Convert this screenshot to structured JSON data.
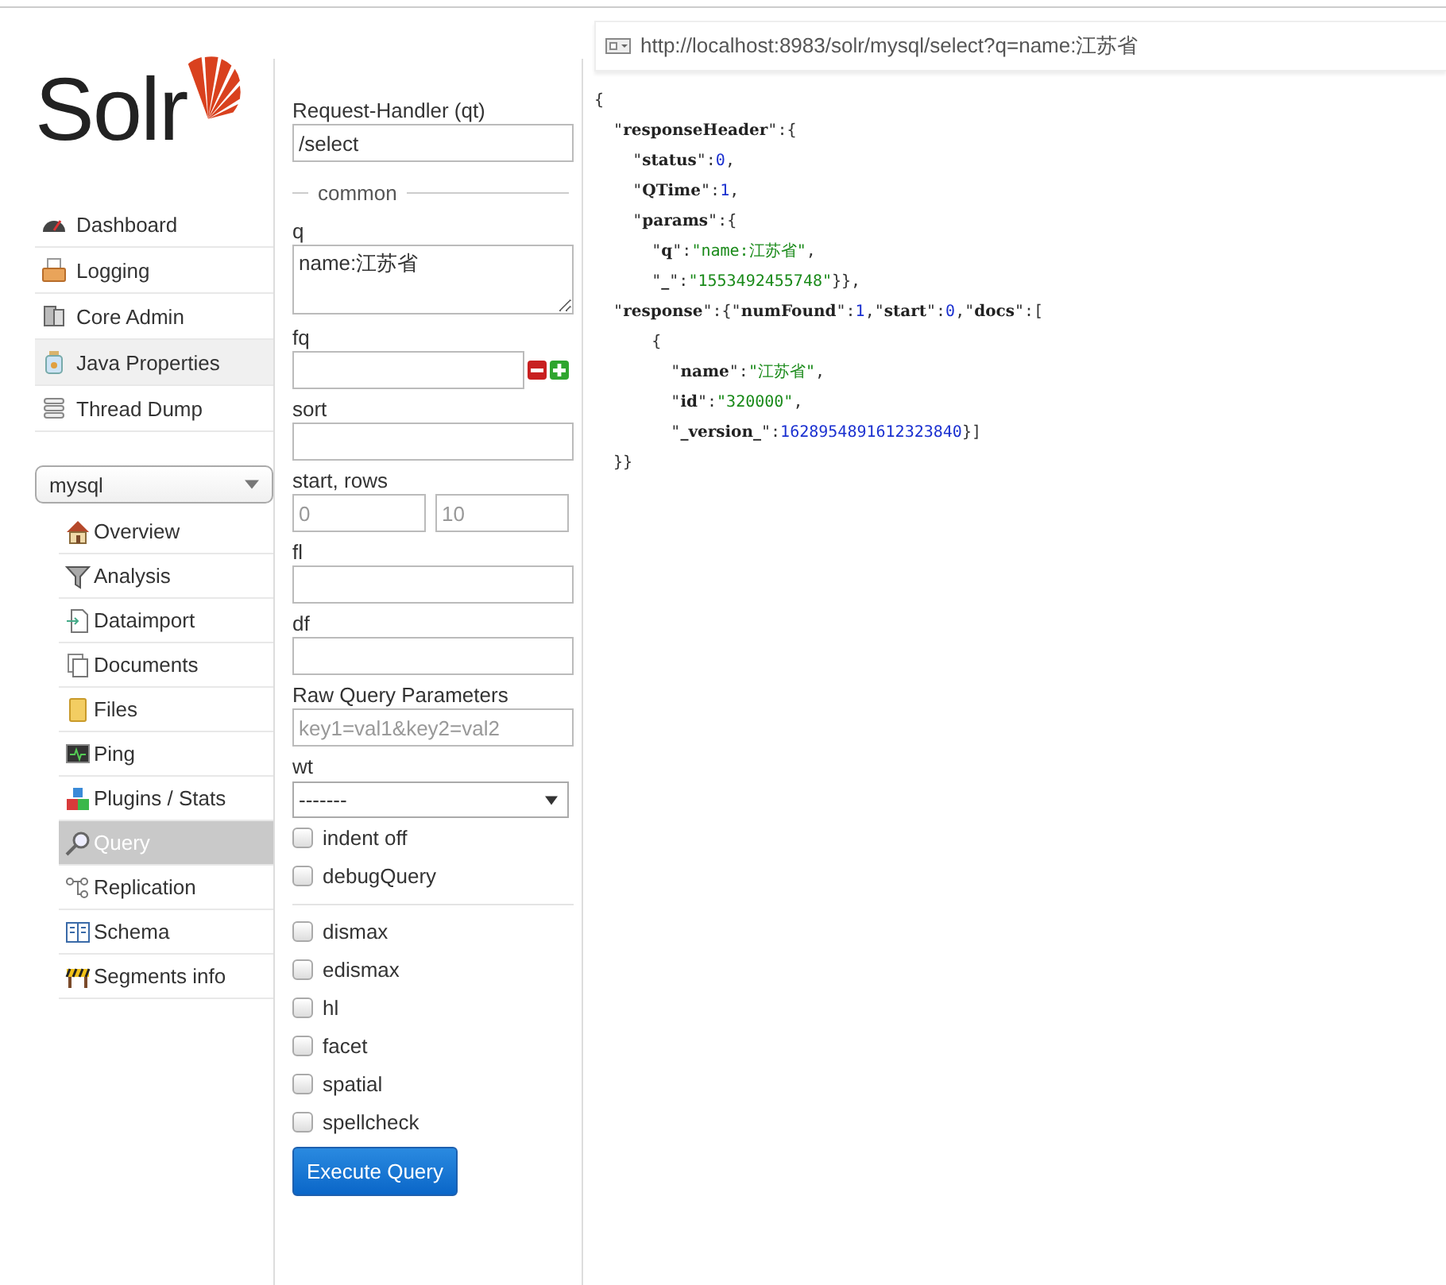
{
  "logo": {
    "text": "Solr"
  },
  "nav": [
    {
      "label": "Dashboard",
      "hover": false
    },
    {
      "label": "Logging",
      "hover": false
    },
    {
      "label": "Core Admin",
      "hover": false
    },
    {
      "label": "Java Properties",
      "hover": true
    },
    {
      "label": "Thread Dump",
      "hover": false
    }
  ],
  "core_selector": {
    "value": "mysql"
  },
  "core_nav": [
    {
      "label": "Overview",
      "selected": false
    },
    {
      "label": "Analysis",
      "selected": false
    },
    {
      "label": "Dataimport",
      "selected": false
    },
    {
      "label": "Documents",
      "selected": false
    },
    {
      "label": "Files",
      "selected": false
    },
    {
      "label": "Ping",
      "selected": false
    },
    {
      "label": "Plugins / Stats",
      "selected": false
    },
    {
      "label": "Query",
      "selected": true
    },
    {
      "label": "Replication",
      "selected": false
    },
    {
      "label": "Schema",
      "selected": false
    },
    {
      "label": "Segments info",
      "selected": false
    }
  ],
  "form": {
    "request_handler": {
      "label": "Request-Handler (qt)",
      "value": "/select"
    },
    "section": "common",
    "q": {
      "label": "q",
      "value": "name:江苏省"
    },
    "fq": {
      "label": "fq"
    },
    "sort": {
      "label": "sort"
    },
    "start_rows": {
      "label": "start, rows",
      "start_placeholder": "0",
      "rows_placeholder": "10"
    },
    "fl": {
      "label": "fl"
    },
    "df": {
      "label": "df"
    },
    "raw": {
      "label": "Raw Query Parameters",
      "placeholder": "key1=val1&key2=val2"
    },
    "wt": {
      "label": "wt",
      "value": "-------"
    },
    "options": [
      {
        "label": "indent off",
        "checked": false
      },
      {
        "label": "debugQuery",
        "checked": false
      }
    ],
    "parsers": [
      {
        "label": "dismax",
        "checked": false
      },
      {
        "label": "edismax",
        "checked": false
      },
      {
        "label": "hl",
        "checked": false
      },
      {
        "label": "facet",
        "checked": false
      },
      {
        "label": "spatial",
        "checked": false
      },
      {
        "label": "spellcheck",
        "checked": false
      }
    ],
    "execute": "Execute Query"
  },
  "result": {
    "url": "http://localhost:8983/solr/mysql/select?q=name:江苏省",
    "lines": [
      [
        {
          "kind": "p",
          "text": "{"
        }
      ],
      [
        {
          "kind": "p",
          "text": "  \""
        },
        {
          "kind": "k",
          "text": "responseHeader"
        },
        {
          "kind": "p",
          "text": "\":{"
        }
      ],
      [
        {
          "kind": "p",
          "text": "    \""
        },
        {
          "kind": "k",
          "text": "status"
        },
        {
          "kind": "p",
          "text": "\":"
        },
        {
          "kind": "n",
          "text": "0"
        },
        {
          "kind": "p",
          "text": ","
        }
      ],
      [
        {
          "kind": "p",
          "text": "    \""
        },
        {
          "kind": "k",
          "text": "QTime"
        },
        {
          "kind": "p",
          "text": "\":"
        },
        {
          "kind": "n",
          "text": "1"
        },
        {
          "kind": "p",
          "text": ","
        }
      ],
      [
        {
          "kind": "p",
          "text": "    \""
        },
        {
          "kind": "k",
          "text": "params"
        },
        {
          "kind": "p",
          "text": "\":{"
        }
      ],
      [
        {
          "kind": "p",
          "text": "      \""
        },
        {
          "kind": "k",
          "text": "q"
        },
        {
          "kind": "p",
          "text": "\":"
        },
        {
          "kind": "s",
          "text": "\"name:江苏省\""
        },
        {
          "kind": "p",
          "text": ","
        }
      ],
      [
        {
          "kind": "p",
          "text": "      \""
        },
        {
          "kind": "k",
          "text": "_"
        },
        {
          "kind": "p",
          "text": "\":"
        },
        {
          "kind": "s",
          "text": "\"1553492455748\""
        },
        {
          "kind": "p",
          "text": "}},"
        }
      ],
      [
        {
          "kind": "p",
          "text": "  \""
        },
        {
          "kind": "k",
          "text": "response"
        },
        {
          "kind": "p",
          "text": "\":{\""
        },
        {
          "kind": "k",
          "text": "numFound"
        },
        {
          "kind": "p",
          "text": "\":"
        },
        {
          "kind": "n",
          "text": "1"
        },
        {
          "kind": "p",
          "text": ",\""
        },
        {
          "kind": "k",
          "text": "start"
        },
        {
          "kind": "p",
          "text": "\":"
        },
        {
          "kind": "n",
          "text": "0"
        },
        {
          "kind": "p",
          "text": ",\""
        },
        {
          "kind": "k",
          "text": "docs"
        },
        {
          "kind": "p",
          "text": "\":["
        }
      ],
      [
        {
          "kind": "p",
          "text": "      {"
        }
      ],
      [
        {
          "kind": "p",
          "text": "        \""
        },
        {
          "kind": "k",
          "text": "name"
        },
        {
          "kind": "p",
          "text": "\":"
        },
        {
          "kind": "s",
          "text": "\"江苏省\""
        },
        {
          "kind": "p",
          "text": ","
        }
      ],
      [
        {
          "kind": "p",
          "text": "        \""
        },
        {
          "kind": "k",
          "text": "id"
        },
        {
          "kind": "p",
          "text": "\":"
        },
        {
          "kind": "s",
          "text": "\"320000\""
        },
        {
          "kind": "p",
          "text": ","
        }
      ],
      [
        {
          "kind": "p",
          "text": "        \""
        },
        {
          "kind": "k",
          "text": "_version_"
        },
        {
          "kind": "p",
          "text": "\":"
        },
        {
          "kind": "n",
          "text": "1628954891612323840"
        },
        {
          "kind": "p",
          "text": "}]"
        }
      ],
      [
        {
          "kind": "p",
          "text": "  }}"
        }
      ]
    ]
  }
}
